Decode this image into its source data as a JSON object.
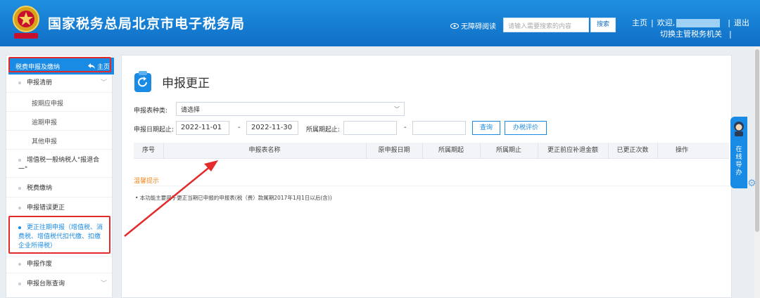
{
  "header": {
    "title": "国家税务总局北京市电子税务局",
    "accessibility_label": "无障碍阅读",
    "search_placeholder": "请输入需要搜索的内容",
    "search_button": "搜索",
    "home_link": "主页",
    "welcome": "欢迎,",
    "logout_link": "退出",
    "switch_authority": "切换主管税务机关",
    "separator": "|"
  },
  "sidebar": {
    "header_label": "税费申报及缴纳",
    "home_label": "主页",
    "items": {
      "declare_list": "申报清册",
      "period_declare": "按期应申报",
      "overdue_declare": "逾期申报",
      "other_declare": "其他申报",
      "vat_merge": "增值税一般纳税人\"报退合一\"",
      "tax_payment": "税费缴纳",
      "error_correction": "申报错误更正",
      "past_correction": "更正往期申报（增值税、消费税、增值税代扣代缴、扣缴企业所得税）",
      "void_declare": "申报作废",
      "ledger_query": "申报台账查询"
    }
  },
  "main": {
    "page_title": "申报更正",
    "form_type_label": "申报表种类:",
    "form_type_value": "请选择",
    "declare_date_label": "申报日期起止:",
    "date_start": "2022-11-01",
    "date_end": "2022-11-30",
    "dash": "-",
    "period_label": "所属期起止:",
    "period_start": "",
    "period_end": "",
    "query_button": "查询",
    "evaluate_button": "办税评价",
    "columns": [
      "序号",
      "申报表名称",
      "原申报日期",
      "所属期起",
      "所属期止",
      "更正前应补退金额",
      "已更正次数",
      "操作"
    ],
    "tip_title": "温馨提示",
    "tip_text": "• 本功能主要用于更正当期已申报的申报表(税（费）款属期2017年1月1日以后(含))"
  },
  "float_widget": {
    "label": "在线导办"
  },
  "colors": {
    "header_blue": "#0f6fc6",
    "accent_blue": "#1a8be5",
    "annotation_red": "#e32b2b",
    "tip_orange": "#f08a24"
  }
}
